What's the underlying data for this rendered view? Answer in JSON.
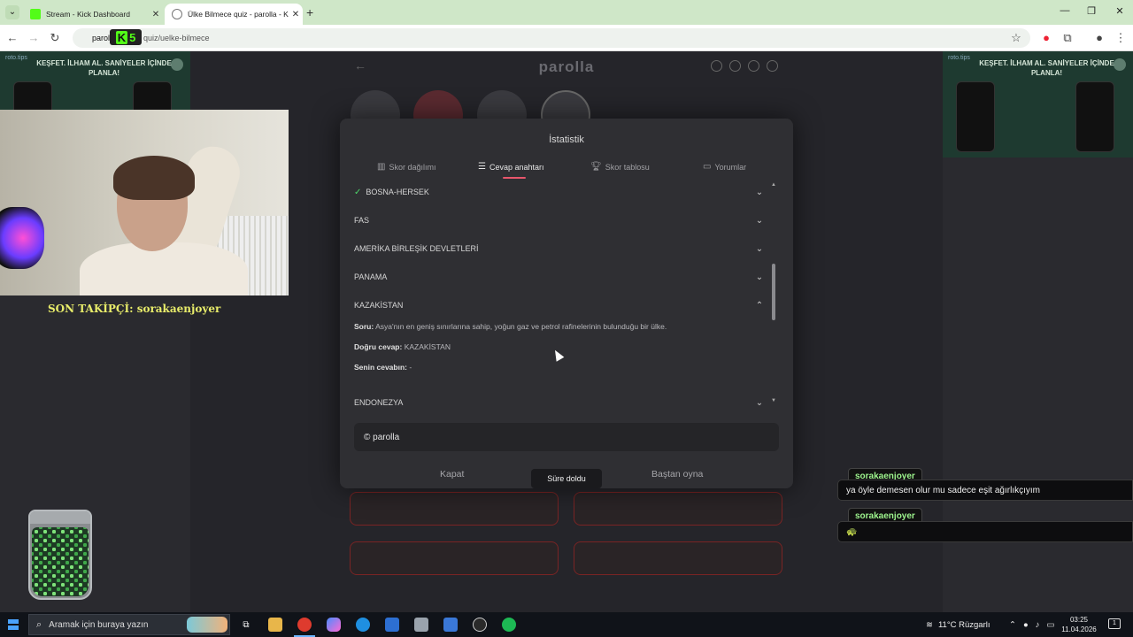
{
  "browser": {
    "tabs": [
      {
        "title": "Stream - Kick Dashboard",
        "favicon_color": "#53fc18"
      },
      {
        "title": "Ülke Bilmece quiz - parolla - Ki",
        "favicon_color": "#777777"
      }
    ],
    "url_host": "parol",
    "url_path": "quiz/uelke-bilmece",
    "kick_badge": "5",
    "kick_badge_k": "K"
  },
  "site": {
    "logo": "parolla",
    "ad": {
      "brand": "roto.tips",
      "title": "KEŞFET. İLHAM AL. SANİYELER İÇİNDE PLANLA!"
    }
  },
  "stream_overlay": {
    "follower_label": "SON TAKİPÇİ: sorakaenjoyer"
  },
  "modal": {
    "title": "İstatistik",
    "tabs": [
      {
        "label": "Skor dağılımı",
        "icon": "bar-chart-icon"
      },
      {
        "label": "Cevap anahtarı",
        "icon": "list-icon",
        "active": true
      },
      {
        "label": "Skor tablosu",
        "icon": "trophy-icon"
      },
      {
        "label": "Yorumlar",
        "icon": "comment-icon"
      }
    ],
    "answers": [
      {
        "name": "BOSNA-HERSEK",
        "correct": true,
        "expanded": false
      },
      {
        "name": "FAS",
        "expanded": false
      },
      {
        "name": "AMERİKA BİRLEŞİK DEVLETLERİ",
        "expanded": false
      },
      {
        "name": "PANAMA",
        "expanded": false
      },
      {
        "name": "KAZAKİSTAN",
        "expanded": true
      },
      {
        "name": "ENDONEZYA",
        "expanded": false
      }
    ],
    "detail": {
      "question_label": "Soru:",
      "question_text": "Asya'nın en geniş sınırlarına sahip, yoğun gaz ve petrol rafinelerinin bulunduğu bir ülke.",
      "correct_label": "Doğru cevap:",
      "correct_value": "KAZAKİSTAN",
      "yours_label": "Senin cevabın:",
      "yours_value": "-"
    },
    "copyright": "© parolla",
    "close_label": "Kapat",
    "restart_label": "Baştan oyna"
  },
  "toast": "Süre doldu",
  "chat": [
    {
      "user": "sorakaenjoyer",
      "message": "ya öyle demesen olur mu sadece eşit ağırlıkçıyım"
    },
    {
      "user": "sorakaenjoyer",
      "message": "🐢"
    }
  ],
  "taskbar": {
    "search_placeholder": "Aramak için buraya yazın",
    "weather": "11°C  Rüzgarlı",
    "time": "03:25",
    "date": "11.04.2026",
    "notifications": "1"
  }
}
